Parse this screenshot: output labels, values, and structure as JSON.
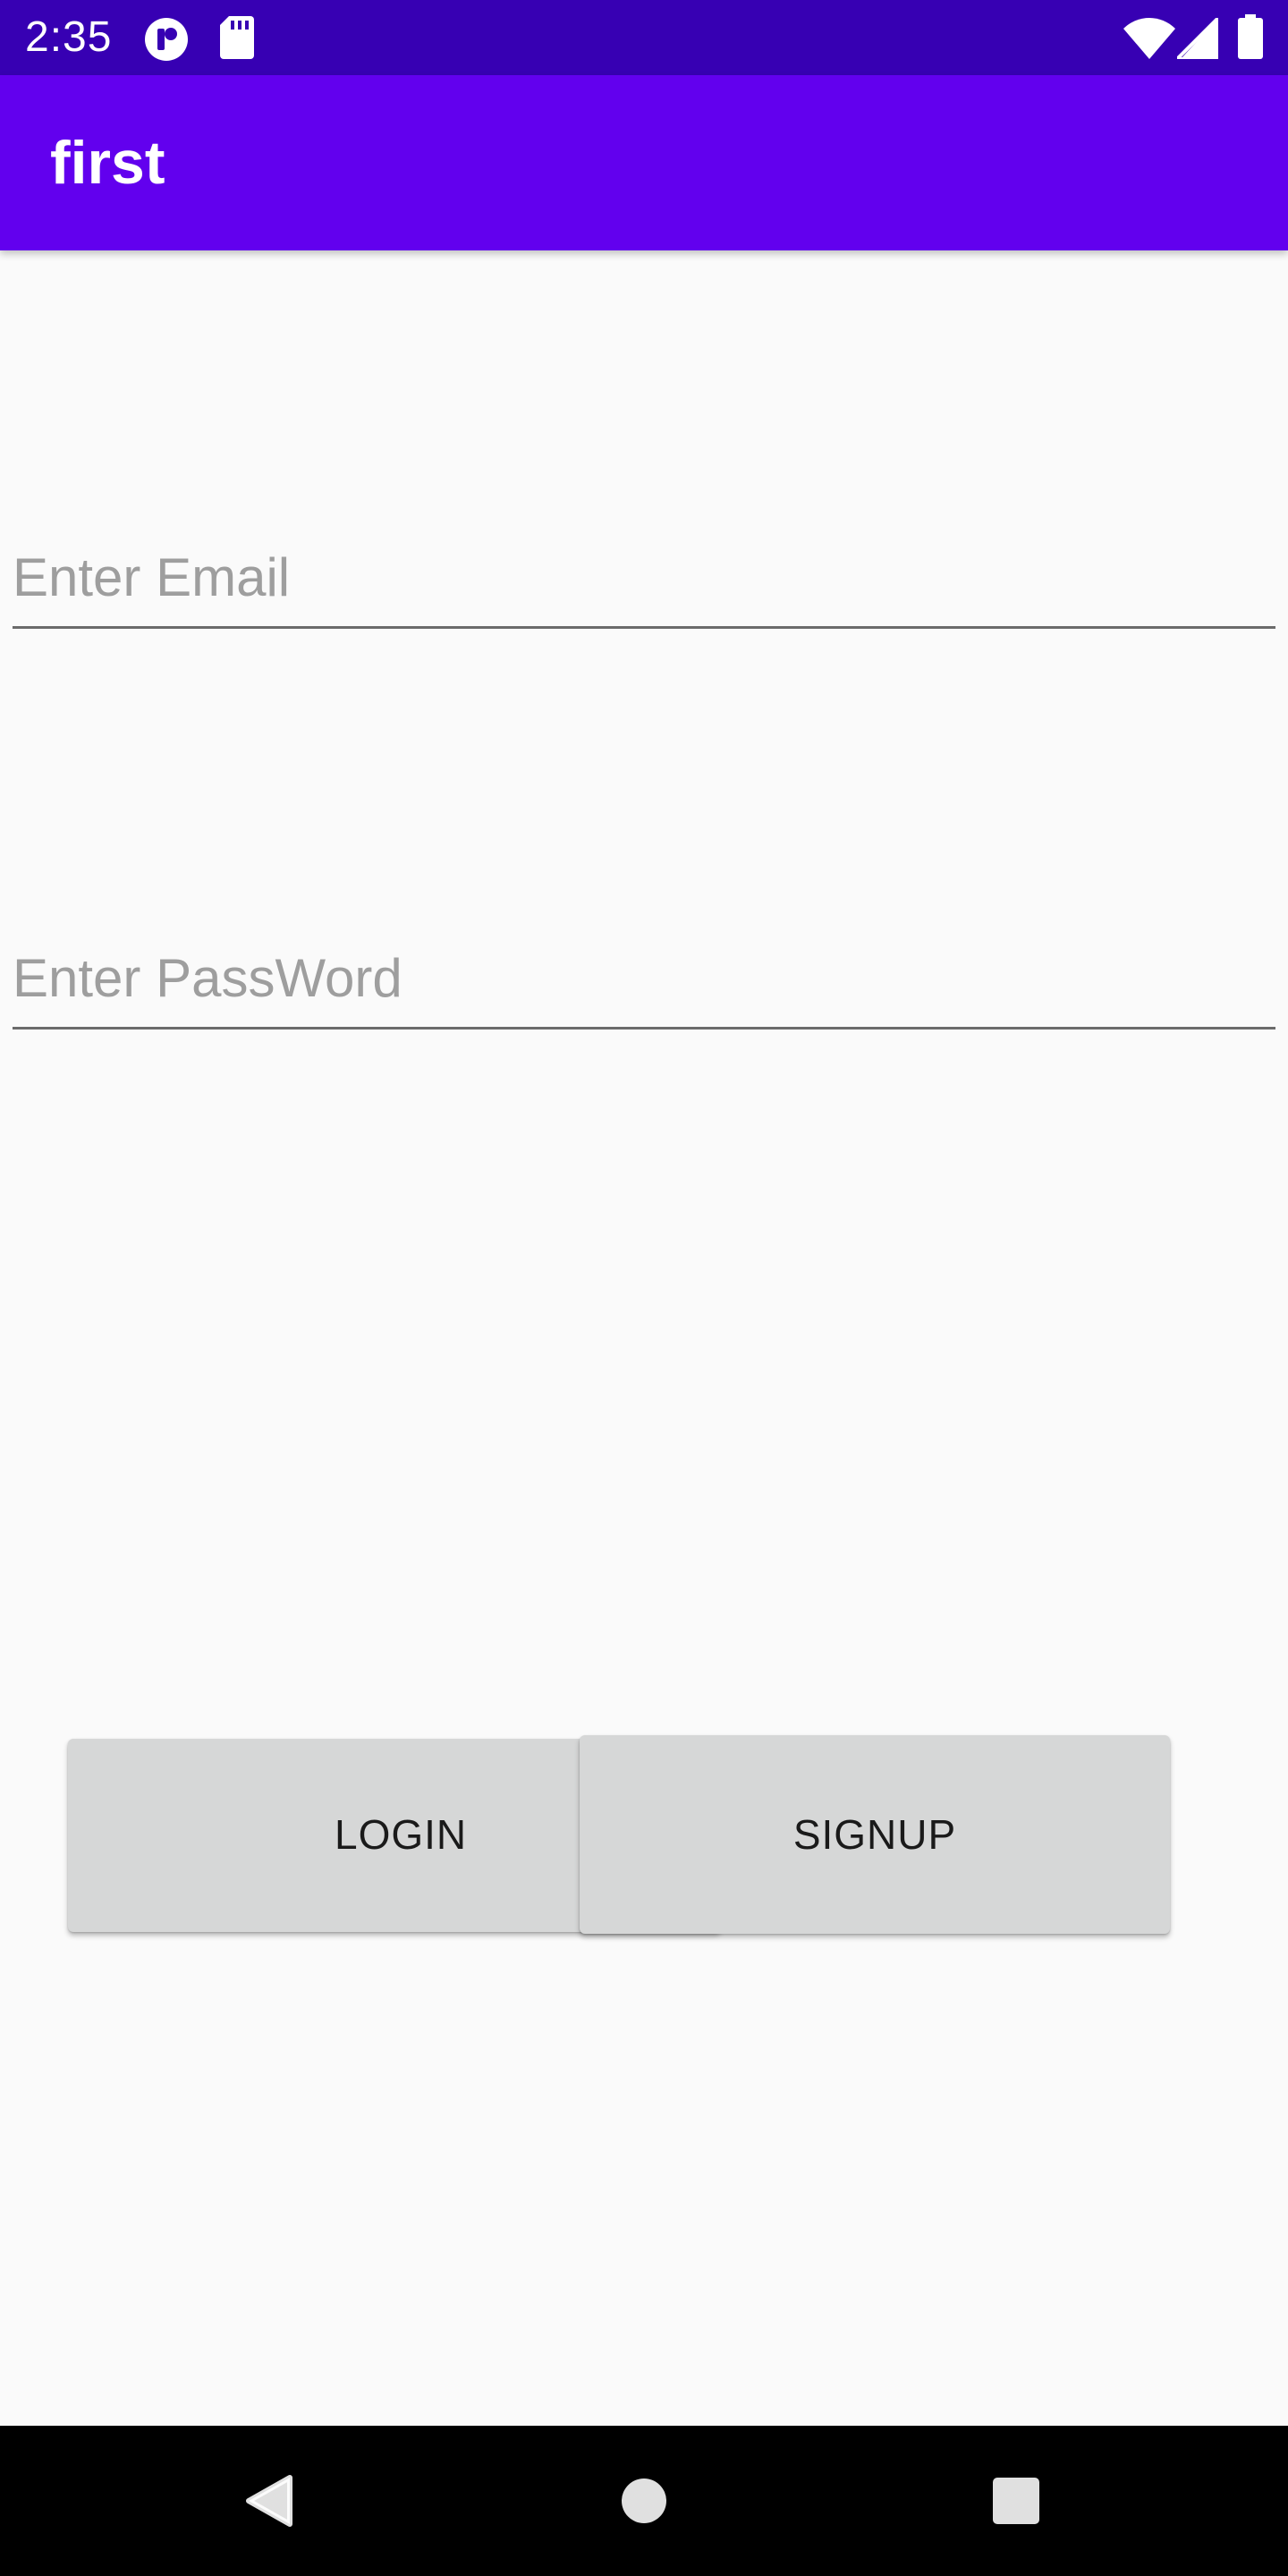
{
  "status_bar": {
    "time": "2:35",
    "icons": [
      "notification-app-icon",
      "sd-card-icon",
      "wifi-icon",
      "signal-icon",
      "battery-icon"
    ],
    "background_color": "#3700b3"
  },
  "app_bar": {
    "title": "first",
    "background_color": "#6200ee"
  },
  "form": {
    "email": {
      "value": "",
      "placeholder": "Enter Email"
    },
    "password": {
      "value": "",
      "placeholder": "Enter PassWord"
    }
  },
  "buttons": {
    "login_label": "LOGIN",
    "signup_label": "SIGNUP",
    "background_color": "#d6d7d7"
  },
  "nav_bar": {
    "icons": [
      "back-icon",
      "home-icon",
      "recents-icon"
    ],
    "background_color": "#000000"
  }
}
